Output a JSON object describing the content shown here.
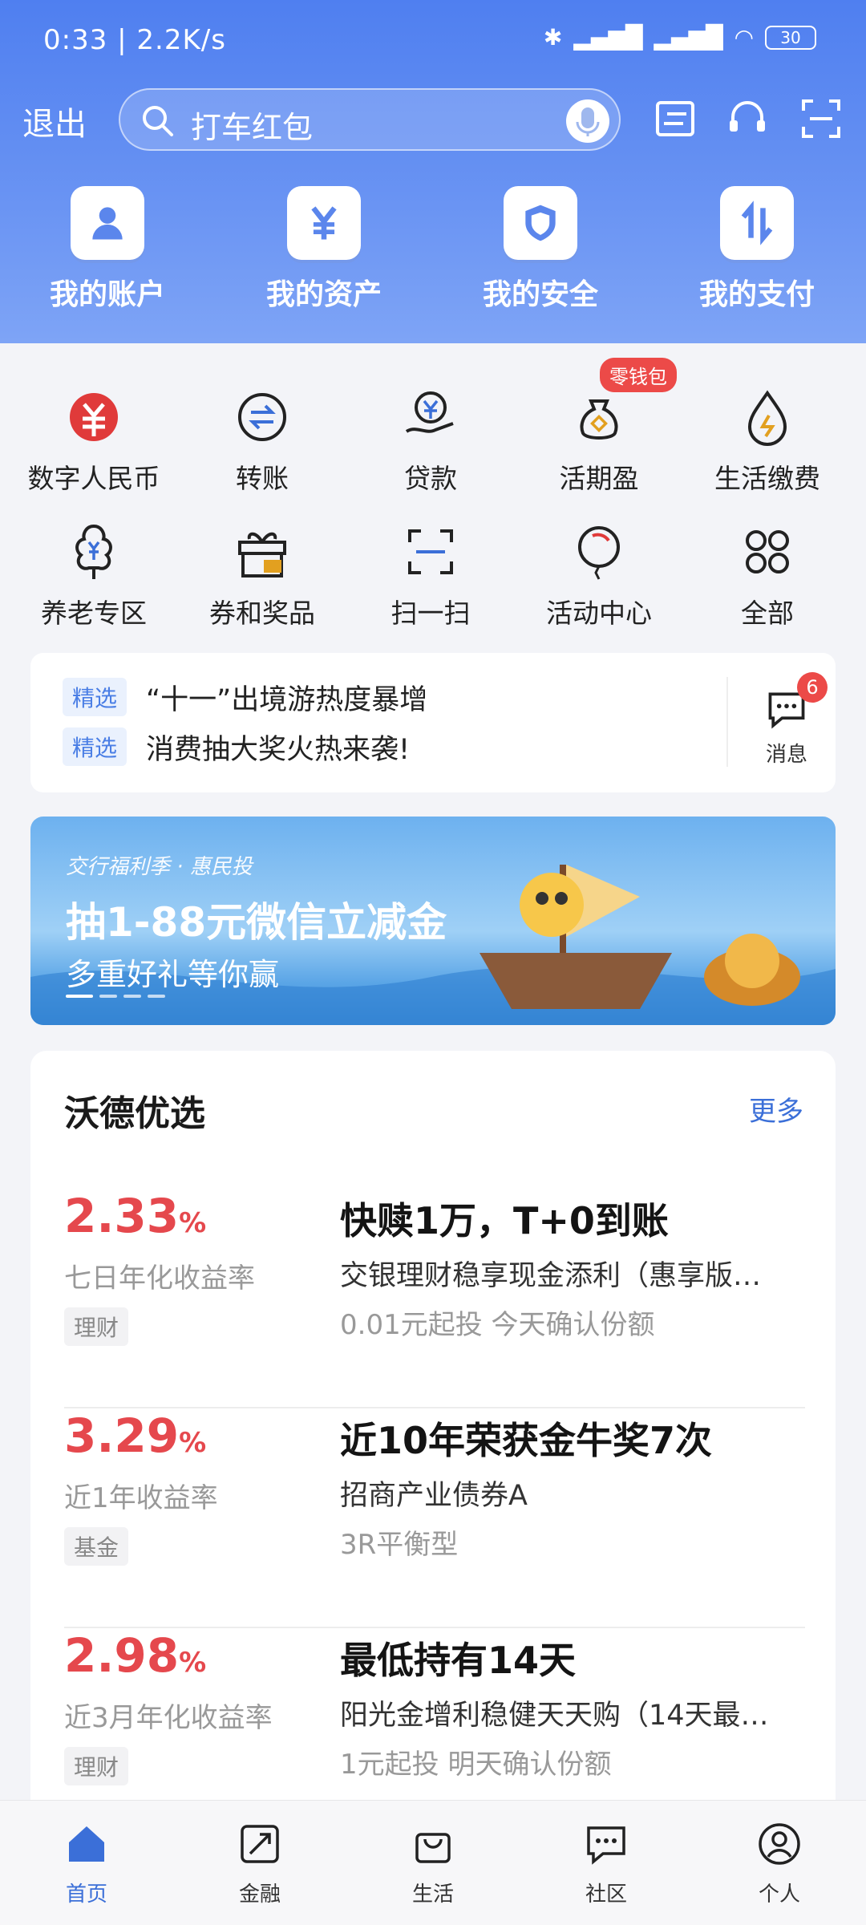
{
  "status_bar": {
    "time": "0:33 | 2.2K/s",
    "battery": "30"
  },
  "header": {
    "exit_label": "退出",
    "search_placeholder": "打车红包",
    "quick_actions": [
      {
        "label": "我的账户",
        "icon": "person-icon"
      },
      {
        "label": "我的资产",
        "icon": "yen-icon"
      },
      {
        "label": "我的安全",
        "icon": "shield-icon"
      },
      {
        "label": "我的支付",
        "icon": "transfer-arrows-icon"
      }
    ]
  },
  "services": [
    {
      "label": "数字人民币",
      "icon": "digital-rmb-icon"
    },
    {
      "label": "转账",
      "icon": "transfer-icon"
    },
    {
      "label": "贷款",
      "icon": "loan-icon"
    },
    {
      "label": "活期盈",
      "icon": "money-bag-icon",
      "badge": "零钱包"
    },
    {
      "label": "生活缴费",
      "icon": "utility-drop-icon"
    },
    {
      "label": "养老专区",
      "icon": "pension-tree-icon"
    },
    {
      "label": "券和奖品",
      "icon": "gift-icon"
    },
    {
      "label": "扫一扫",
      "icon": "scan-icon"
    },
    {
      "label": "活动中心",
      "icon": "balloon-icon"
    },
    {
      "label": "全部",
      "icon": "grid-icon"
    }
  ],
  "news": {
    "items": [
      {
        "tag": "精选",
        "text": "“十一”出境游热度暴增"
      },
      {
        "tag": "精选",
        "text": "消费抽大奖火热来袭!"
      }
    ],
    "message_label": "消息",
    "message_count": "6"
  },
  "banner": {
    "subtitle": "交行福利季 · 惠民投",
    "title": "抽1-88元微信立减金",
    "line2": "多重好礼等你赢"
  },
  "picks": {
    "title": "沃德优选",
    "more_label": "更多",
    "products": [
      {
        "rate": "2.33",
        "unit": "%",
        "rate_label": "七日年化收益率",
        "kind": "理财",
        "headline": "快赎1万，T+0到账",
        "name": "交银理财稳享现金添利（惠享版…",
        "meta": "0.01元起投 今天确认份额"
      },
      {
        "rate": "3.29",
        "unit": "%",
        "rate_label": "近1年收益率",
        "kind": "基金",
        "headline": "近10年荣获金牛奖7次",
        "name": "招商产业债券A",
        "meta": "3R平衡型"
      },
      {
        "rate": "2.98",
        "unit": "%",
        "rate_label": "近3月年化收益率",
        "kind": "理财",
        "headline": "最低持有14天",
        "name": "阳光金增利稳健天天购（14天最…",
        "meta": "1元起投 明天确认份额"
      }
    ]
  },
  "tabbar": [
    {
      "label": "首页",
      "icon": "home-icon",
      "active": true
    },
    {
      "label": "金融",
      "icon": "finance-icon",
      "active": false
    },
    {
      "label": "生活",
      "icon": "shopping-bag-icon",
      "active": false
    },
    {
      "label": "社区",
      "icon": "chat-bubble-icon",
      "active": false
    },
    {
      "label": "个人",
      "icon": "profile-icon",
      "active": false
    }
  ],
  "colors": {
    "accent": "#3b6fd8",
    "rate_red": "#e5484d",
    "header_blue": "#4f7ff0",
    "badge_red": "#ec4a48"
  }
}
